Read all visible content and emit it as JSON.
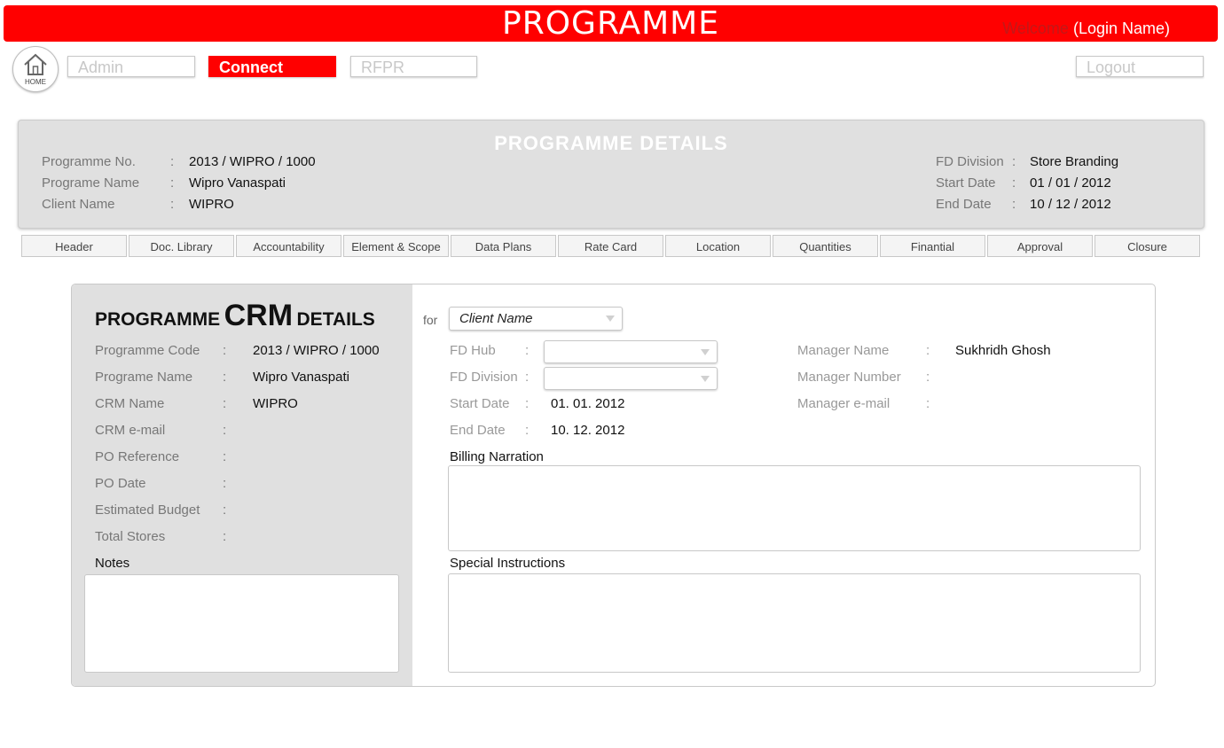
{
  "header": {
    "title": "PROGRAMME",
    "welcome": "Welcome",
    "login_name": "(Login Name)"
  },
  "nav": {
    "home_label": "HOME",
    "admin": "Admin",
    "connect": "Connect",
    "rfpr": "RFPR",
    "logout": "Logout"
  },
  "programme_details": {
    "title": "PROGRAMME  DETAILS",
    "left": [
      {
        "label": "Programme  No.",
        "value": "2013 / WIPRO / 1000"
      },
      {
        "label": "Programe Name",
        "value": "Wipro Vanaspati"
      },
      {
        "label": "Client  Name",
        "value": "WIPRO"
      }
    ],
    "right": [
      {
        "label": "FD Division",
        "value": "Store Branding"
      },
      {
        "label": "Start Date",
        "value": "01 / 01 / 2012"
      },
      {
        "label": "End Date",
        "value": "10 / 12 / 2012"
      }
    ]
  },
  "tabs": [
    "Header",
    "Doc. Library",
    "Accountability",
    "Element & Scope",
    "Data Plans",
    "Rate Card",
    "Location",
    "Quantities",
    "Finantial",
    "Approval",
    "Closure"
  ],
  "crm": {
    "title_pre": "PROGRAMME",
    "title_mid": "CRM",
    "title_post": "DETAILS",
    "fields": [
      {
        "label": "Programme Code",
        "value": "2013 / WIPRO / 1000"
      },
      {
        "label": "Programe Name",
        "value": "Wipro Vanaspati"
      },
      {
        "label": "CRM  Name",
        "value": "WIPRO"
      },
      {
        "label": "CRM  e-mail",
        "value": ""
      },
      {
        "label": "PO Reference",
        "value": ""
      },
      {
        "label": "PO Date",
        "value": ""
      },
      {
        "label": "Estimated Budget",
        "value": ""
      },
      {
        "label": "Total Stores",
        "value": ""
      }
    ],
    "notes_label": "Notes",
    "for_label": "for",
    "client_select": "Client Name",
    "mid_fields": [
      {
        "label": "FD Hub",
        "value": ""
      },
      {
        "label": "FD Division",
        "value": ""
      },
      {
        "label": "Start Date",
        "value": "01. 01. 2012"
      },
      {
        "label": "End Date",
        "value": "10. 12. 2012"
      }
    ],
    "manager_fields": [
      {
        "label": "Manager Name",
        "value": "Sukhridh Ghosh"
      },
      {
        "label": "Manager Number",
        "value": ""
      },
      {
        "label": "Manager e-mail",
        "value": ""
      }
    ],
    "billing_label": "Billing Narration",
    "special_label": "Special Instructions"
  }
}
